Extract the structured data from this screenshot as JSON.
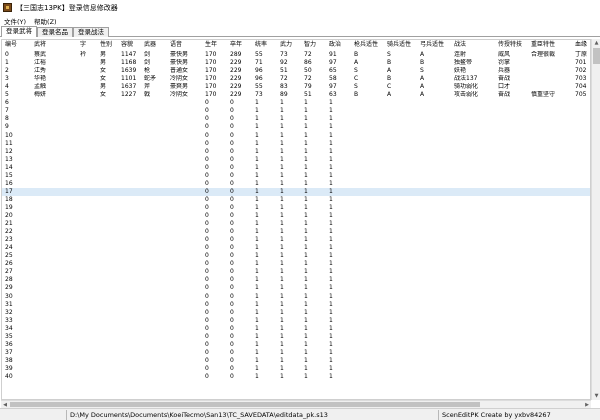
{
  "window": {
    "title": "【三国志13PK】登录信息修改器"
  },
  "menu": [
    "文件(Y)",
    "帮助(Z)"
  ],
  "tabs": [
    {
      "label": "登录武将",
      "active": true
    },
    {
      "label": "登录名品",
      "active": false
    },
    {
      "label": "登录战法",
      "active": false
    }
  ],
  "table": {
    "columns": [
      "编号",
      "武将",
      "字",
      "性别",
      "容貌",
      "武器",
      "语音",
      "生年",
      "卒年",
      "统率",
      "武力",
      "智力",
      "政治",
      "枪兵适性",
      "骑兵适性",
      "弓兵适性",
      "战法",
      "传授特技",
      "重臣特性",
      "血缘"
    ],
    "rows": [
      [
        "0",
        "蔡武",
        "衿",
        "男",
        "1147",
        "剑",
        "豪快男",
        "170",
        "289",
        "55",
        "73",
        "72",
        "91",
        "B",
        "S",
        "A",
        "连射",
        "威风",
        "合理很裁",
        "丁原"
      ],
      [
        "1",
        "江裕",
        "",
        "男",
        "1168",
        "剑",
        "豪快男",
        "170",
        "229",
        "71",
        "92",
        "86",
        "97",
        "A",
        "B",
        "B",
        "独鳌帝",
        "罚掌",
        "",
        "701"
      ],
      [
        "2",
        "江秀",
        "",
        "女",
        "1639",
        "枪",
        "普通女",
        "170",
        "229",
        "96",
        "51",
        "50",
        "65",
        "S",
        "A",
        "S",
        "妖艳",
        "兵器",
        "",
        "702"
      ],
      [
        "3",
        "华艳",
        "",
        "女",
        "1101",
        "蛇矛",
        "冷阴女",
        "170",
        "229",
        "96",
        "72",
        "72",
        "58",
        "C",
        "B",
        "A",
        "战法137",
        "奋战",
        "",
        "703"
      ],
      [
        "4",
        "孟触",
        "",
        "男",
        "1637",
        "斧",
        "豪爽男",
        "170",
        "229",
        "55",
        "83",
        "79",
        "97",
        "S",
        "C",
        "A",
        "骑功弱化",
        "口才",
        "",
        "704"
      ],
      [
        "5",
        "梅妍",
        "",
        "女",
        "1227",
        "戟",
        "冷阴女",
        "170",
        "229",
        "73",
        "89",
        "51",
        "63",
        "B",
        "A",
        "A",
        "攻击弱化",
        "奋战",
        "慎重坚守",
        "705"
      ],
      [
        "6",
        "",
        "",
        "",
        "",
        "",
        "",
        "0",
        "0",
        "1",
        "1",
        "1",
        "1",
        "",
        "",
        "",
        "",
        "",
        "",
        ""
      ],
      [
        "7",
        "",
        "",
        "",
        "",
        "",
        "",
        "0",
        "0",
        "1",
        "1",
        "1",
        "1",
        "",
        "",
        "",
        "",
        "",
        "",
        ""
      ],
      [
        "8",
        "",
        "",
        "",
        "",
        "",
        "",
        "0",
        "0",
        "1",
        "1",
        "1",
        "1",
        "",
        "",
        "",
        "",
        "",
        "",
        ""
      ],
      [
        "9",
        "",
        "",
        "",
        "",
        "",
        "",
        "0",
        "0",
        "1",
        "1",
        "1",
        "1",
        "",
        "",
        "",
        "",
        "",
        "",
        ""
      ],
      [
        "10",
        "",
        "",
        "",
        "",
        "",
        "",
        "0",
        "0",
        "1",
        "1",
        "1",
        "1",
        "",
        "",
        "",
        "",
        "",
        "",
        ""
      ],
      [
        "11",
        "",
        "",
        "",
        "",
        "",
        "",
        "0",
        "0",
        "1",
        "1",
        "1",
        "1",
        "",
        "",
        "",
        "",
        "",
        "",
        ""
      ],
      [
        "12",
        "",
        "",
        "",
        "",
        "",
        "",
        "0",
        "0",
        "1",
        "1",
        "1",
        "1",
        "",
        "",
        "",
        "",
        "",
        "",
        ""
      ],
      [
        "13",
        "",
        "",
        "",
        "",
        "",
        "",
        "0",
        "0",
        "1",
        "1",
        "1",
        "1",
        "",
        "",
        "",
        "",
        "",
        "",
        ""
      ],
      [
        "14",
        "",
        "",
        "",
        "",
        "",
        "",
        "0",
        "0",
        "1",
        "1",
        "1",
        "1",
        "",
        "",
        "",
        "",
        "",
        "",
        ""
      ],
      [
        "15",
        "",
        "",
        "",
        "",
        "",
        "",
        "0",
        "0",
        "1",
        "1",
        "1",
        "1",
        "",
        "",
        "",
        "",
        "",
        "",
        ""
      ],
      [
        "16",
        "",
        "",
        "",
        "",
        "",
        "",
        "0",
        "0",
        "1",
        "1",
        "1",
        "1",
        "",
        "",
        "",
        "",
        "",
        "",
        ""
      ],
      [
        "17",
        "",
        "",
        "",
        "",
        "",
        "",
        "0",
        "0",
        "1",
        "1",
        "1",
        "1",
        "",
        "",
        "",
        "",
        "",
        "",
        ""
      ],
      [
        "18",
        "",
        "",
        "",
        "",
        "",
        "",
        "0",
        "0",
        "1",
        "1",
        "1",
        "1",
        "",
        "",
        "",
        "",
        "",
        "",
        ""
      ],
      [
        "19",
        "",
        "",
        "",
        "",
        "",
        "",
        "0",
        "0",
        "1",
        "1",
        "1",
        "1",
        "",
        "",
        "",
        "",
        "",
        "",
        ""
      ],
      [
        "20",
        "",
        "",
        "",
        "",
        "",
        "",
        "0",
        "0",
        "1",
        "1",
        "1",
        "1",
        "",
        "",
        "",
        "",
        "",
        "",
        ""
      ],
      [
        "21",
        "",
        "",
        "",
        "",
        "",
        "",
        "0",
        "0",
        "1",
        "1",
        "1",
        "1",
        "",
        "",
        "",
        "",
        "",
        "",
        ""
      ],
      [
        "22",
        "",
        "",
        "",
        "",
        "",
        "",
        "0",
        "0",
        "1",
        "1",
        "1",
        "1",
        "",
        "",
        "",
        "",
        "",
        "",
        ""
      ],
      [
        "23",
        "",
        "",
        "",
        "",
        "",
        "",
        "0",
        "0",
        "1",
        "1",
        "1",
        "1",
        "",
        "",
        "",
        "",
        "",
        "",
        ""
      ],
      [
        "24",
        "",
        "",
        "",
        "",
        "",
        "",
        "0",
        "0",
        "1",
        "1",
        "1",
        "1",
        "",
        "",
        "",
        "",
        "",
        "",
        ""
      ],
      [
        "25",
        "",
        "",
        "",
        "",
        "",
        "",
        "0",
        "0",
        "1",
        "1",
        "1",
        "1",
        "",
        "",
        "",
        "",
        "",
        "",
        ""
      ],
      [
        "26",
        "",
        "",
        "",
        "",
        "",
        "",
        "0",
        "0",
        "1",
        "1",
        "1",
        "1",
        "",
        "",
        "",
        "",
        "",
        "",
        ""
      ],
      [
        "27",
        "",
        "",
        "",
        "",
        "",
        "",
        "0",
        "0",
        "1",
        "1",
        "1",
        "1",
        "",
        "",
        "",
        "",
        "",
        "",
        ""
      ],
      [
        "28",
        "",
        "",
        "",
        "",
        "",
        "",
        "0",
        "0",
        "1",
        "1",
        "1",
        "1",
        "",
        "",
        "",
        "",
        "",
        "",
        ""
      ],
      [
        "29",
        "",
        "",
        "",
        "",
        "",
        "",
        "0",
        "0",
        "1",
        "1",
        "1",
        "1",
        "",
        "",
        "",
        "",
        "",
        "",
        ""
      ],
      [
        "30",
        "",
        "",
        "",
        "",
        "",
        "",
        "0",
        "0",
        "1",
        "1",
        "1",
        "1",
        "",
        "",
        "",
        "",
        "",
        "",
        ""
      ],
      [
        "31",
        "",
        "",
        "",
        "",
        "",
        "",
        "0",
        "0",
        "1",
        "1",
        "1",
        "1",
        "",
        "",
        "",
        "",
        "",
        "",
        ""
      ],
      [
        "32",
        "",
        "",
        "",
        "",
        "",
        "",
        "0",
        "0",
        "1",
        "1",
        "1",
        "1",
        "",
        "",
        "",
        "",
        "",
        "",
        ""
      ],
      [
        "33",
        "",
        "",
        "",
        "",
        "",
        "",
        "0",
        "0",
        "1",
        "1",
        "1",
        "1",
        "",
        "",
        "",
        "",
        "",
        "",
        ""
      ],
      [
        "34",
        "",
        "",
        "",
        "",
        "",
        "",
        "0",
        "0",
        "1",
        "1",
        "1",
        "1",
        "",
        "",
        "",
        "",
        "",
        "",
        ""
      ],
      [
        "35",
        "",
        "",
        "",
        "",
        "",
        "",
        "0",
        "0",
        "1",
        "1",
        "1",
        "1",
        "",
        "",
        "",
        "",
        "",
        "",
        ""
      ],
      [
        "36",
        "",
        "",
        "",
        "",
        "",
        "",
        "0",
        "0",
        "1",
        "1",
        "1",
        "1",
        "",
        "",
        "",
        "",
        "",
        "",
        ""
      ],
      [
        "37",
        "",
        "",
        "",
        "",
        "",
        "",
        "0",
        "0",
        "1",
        "1",
        "1",
        "1",
        "",
        "",
        "",
        "",
        "",
        "",
        ""
      ],
      [
        "38",
        "",
        "",
        "",
        "",
        "",
        "",
        "0",
        "0",
        "1",
        "1",
        "1",
        "1",
        "",
        "",
        "",
        "",
        "",
        "",
        ""
      ],
      [
        "39",
        "",
        "",
        "",
        "",
        "",
        "",
        "0",
        "0",
        "1",
        "1",
        "1",
        "1",
        "",
        "",
        "",
        "",
        "",
        "",
        ""
      ],
      [
        "40",
        "",
        "",
        "",
        "",
        "",
        "",
        "0",
        "0",
        "1",
        "1",
        "1",
        "1",
        "",
        "",
        "",
        "",
        "",
        "",
        ""
      ]
    ],
    "selected_row": "17"
  },
  "status": {
    "path": "D:\\My Documents\\Documents\\KoeiTecmo\\San13\\TC_SAVEDATA\\editdata_pk.s13",
    "credit": "ScenEditPK Create by yxbv84267"
  },
  "icons": {
    "app": "app-icon",
    "scroll_up": "scroll-up-icon",
    "scroll_down": "scroll-down-icon",
    "scroll_left": "scroll-left-icon",
    "scroll_right": "scroll-right-icon"
  }
}
